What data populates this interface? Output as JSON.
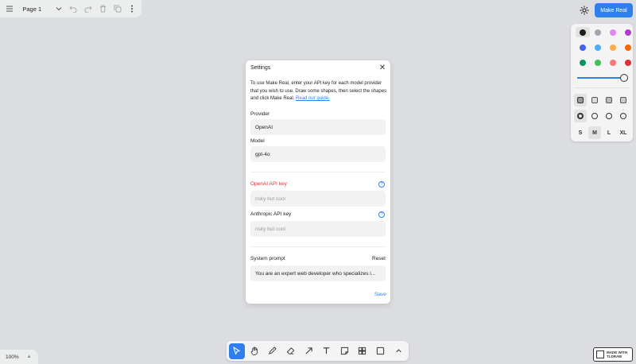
{
  "topbar": {
    "page_name": "Page 1"
  },
  "header": {
    "make_real_label": "Make Real",
    "accent": "#2f80ed"
  },
  "style_panel": {
    "colors": [
      "#1d1d1d",
      "#9fa8b2",
      "#e085f4",
      "#ae3ec9",
      "#4263eb",
      "#4dabf7",
      "#ffa94d",
      "#f76707",
      "#099268",
      "#40c057",
      "#f87777",
      "#e03131"
    ],
    "selected_color_index": 0,
    "opacity": 1.0,
    "sizes": [
      "S",
      "M",
      "L",
      "XL"
    ],
    "selected_size": "M"
  },
  "dialog": {
    "title": "Settings",
    "description": "To use Make Real, enter your API key for each model provider that you wish to use. Draw some shapes, then select the shapes and click Make Real.",
    "link_text": "Read our guide.",
    "provider_label": "Provider",
    "provider_value": "OpenAI",
    "model_label": "Model",
    "model_value": "gpt-4o",
    "openai_key_label": "OpenAI API key",
    "openai_key_placeholder": "risky but cool",
    "anthropic_key_label": "Anthropic API key",
    "anthropic_key_placeholder": "risky but cool",
    "system_prompt_label": "System prompt",
    "reset_label": "Reset",
    "system_prompt_value": "You are an expert web developer who specializes i...",
    "save_label": "Save"
  },
  "footer": {
    "zoom": "100%",
    "made_with_line1": "MADE WITH",
    "made_with_line2": "TLDRAW"
  },
  "toolbar": {
    "tools": [
      "select-tool",
      "hand-tool",
      "draw-tool",
      "eraser-tool",
      "arrow-tool",
      "text-tool",
      "note-tool",
      "asset-tool",
      "rectangle-tool",
      "more-tools"
    ]
  }
}
